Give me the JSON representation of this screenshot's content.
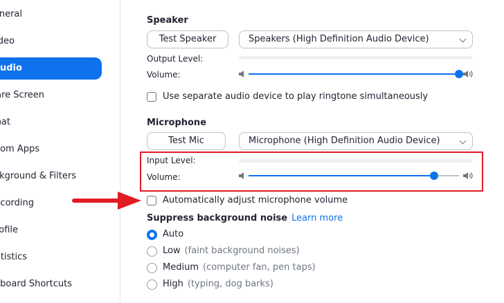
{
  "sidebar": {
    "items": [
      {
        "label": "eneral",
        "active": false
      },
      {
        "label": "deo",
        "active": false
      },
      {
        "label": "udio",
        "active": true
      },
      {
        "label": "are Screen",
        "active": false
      },
      {
        "label": "hat",
        "active": false
      },
      {
        "label": "om Apps",
        "active": false
      },
      {
        "label": "ackground & Filters",
        "active": false
      },
      {
        "label": "ecording",
        "active": false
      },
      {
        "label": "ofile",
        "active": false
      },
      {
        "label": "tatistics",
        "active": false
      },
      {
        "label": "eyboard Shortcuts",
        "active": false
      }
    ]
  },
  "speaker": {
    "title": "Speaker",
    "test_button": "Test Speaker",
    "device": "Speakers (High Definition Audio Device)",
    "output_level_label": "Output Level:",
    "volume_label": "Volume:",
    "volume_percent": 100,
    "separate_device_label": "Use separate audio device to play ringtone simultaneously",
    "separate_device_checked": false
  },
  "microphone": {
    "title": "Microphone",
    "test_button": "Test Mic",
    "device": "Microphone (High Definition Audio Device)",
    "input_level_label": "Input Level:",
    "volume_label": "Volume:",
    "volume_percent": 88,
    "auto_adjust_label": "Automatically adjust microphone volume",
    "auto_adjust_checked": false
  },
  "noise": {
    "title": "Suppress background noise",
    "learn_more": "Learn more",
    "options": [
      {
        "label": "Auto",
        "hint": "",
        "selected": true
      },
      {
        "label": "Low",
        "hint": "(faint background noises)",
        "selected": false
      },
      {
        "label": "Medium",
        "hint": "(computer fan, pen taps)",
        "selected": false
      },
      {
        "label": "High",
        "hint": "(typing, dog barks)",
        "selected": false
      }
    ]
  },
  "colors": {
    "accent": "#0e72ed",
    "annotation": "#e31b23"
  }
}
